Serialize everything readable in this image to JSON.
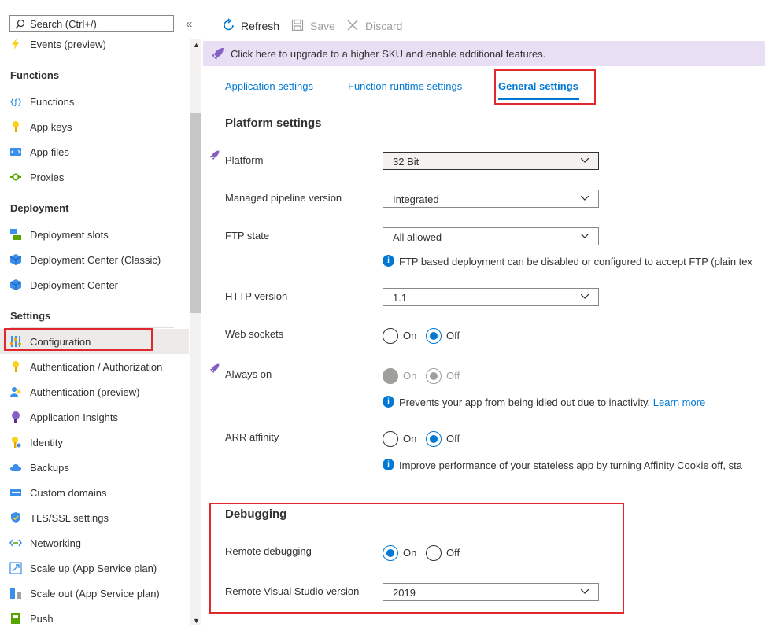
{
  "sidebar": {
    "search_placeholder": "Search (Ctrl+/)",
    "collapse_glyph": "«",
    "top_item": "Events (preview)",
    "sections": {
      "functions": "Functions",
      "deployment": "Deployment",
      "settings": "Settings"
    },
    "items": {
      "functions": "Functions",
      "app_keys": "App keys",
      "app_files": "App files",
      "proxies": "Proxies",
      "deployment_slots": "Deployment slots",
      "deployment_center_classic": "Deployment Center (Classic)",
      "deployment_center": "Deployment Center",
      "configuration": "Configuration",
      "auth_authorization": "Authentication / Authorization",
      "auth_preview": "Authentication (preview)",
      "app_insights": "Application Insights",
      "identity": "Identity",
      "backups": "Backups",
      "custom_domains": "Custom domains",
      "tls_ssl": "TLS/SSL settings",
      "networking": "Networking",
      "scale_up": "Scale up (App Service plan)",
      "scale_out": "Scale out (App Service plan)",
      "push": "Push"
    }
  },
  "toolbar": {
    "refresh": "Refresh",
    "save": "Save",
    "discard": "Discard"
  },
  "banner": "Click here to upgrade to a higher SKU and enable additional features.",
  "tabs": {
    "app_settings": "Application settings",
    "runtime_settings": "Function runtime settings",
    "general_settings": "General settings"
  },
  "platform": {
    "heading": "Platform settings",
    "platform_label": "Platform",
    "platform_value": "32 Bit",
    "pipeline_label": "Managed pipeline version",
    "pipeline_value": "Integrated",
    "ftp_label": "FTP state",
    "ftp_value": "All allowed",
    "ftp_info": "FTP based deployment can be disabled or configured to accept FTP (plain tex",
    "http_label": "HTTP version",
    "http_value": "1.1",
    "websockets_label": "Web sockets",
    "always_on_label": "Always on",
    "always_on_info": "Prevents your app from being idled out due to inactivity.",
    "learn_more": "Learn more",
    "arr_label": "ARR affinity",
    "arr_info": "Improve performance of your stateless app by turning Affinity Cookie off, sta",
    "on": "On",
    "off": "Off"
  },
  "debugging": {
    "heading": "Debugging",
    "remote_label": "Remote debugging",
    "vs_label": "Remote Visual Studio version",
    "vs_value": "2019"
  },
  "colors": {
    "accent": "#0078d4",
    "highlight": "#e0282e",
    "banner_bg": "#e8dff5",
    "rocket": "#8661c5"
  }
}
